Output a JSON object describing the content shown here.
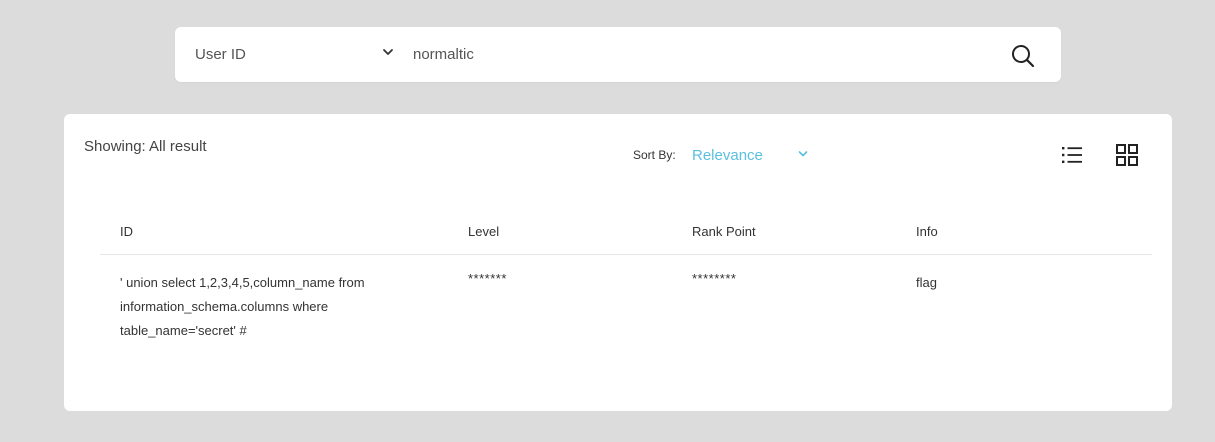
{
  "search": {
    "type_selected": "User ID",
    "query_value": "normaltic"
  },
  "results": {
    "showing_label": "Showing: All result",
    "sort_label": "Sort By:",
    "sort_value": "Relevance",
    "accent_color": "#5bc0de",
    "columns": {
      "id": "ID",
      "level": "Level",
      "rank_point": "Rank Point",
      "info": "Info"
    },
    "rows": [
      {
        "id": "' union select 1,2,3,4,5,column_name from information_schema.columns where table_name='secret' #",
        "level": "*******",
        "rank_point": "********",
        "info": "flag"
      }
    ]
  },
  "icons": {
    "search": "search-icon",
    "chevron": "chevron-down-icon",
    "list_view": "list-view-icon",
    "grid_view": "grid-view-icon"
  }
}
